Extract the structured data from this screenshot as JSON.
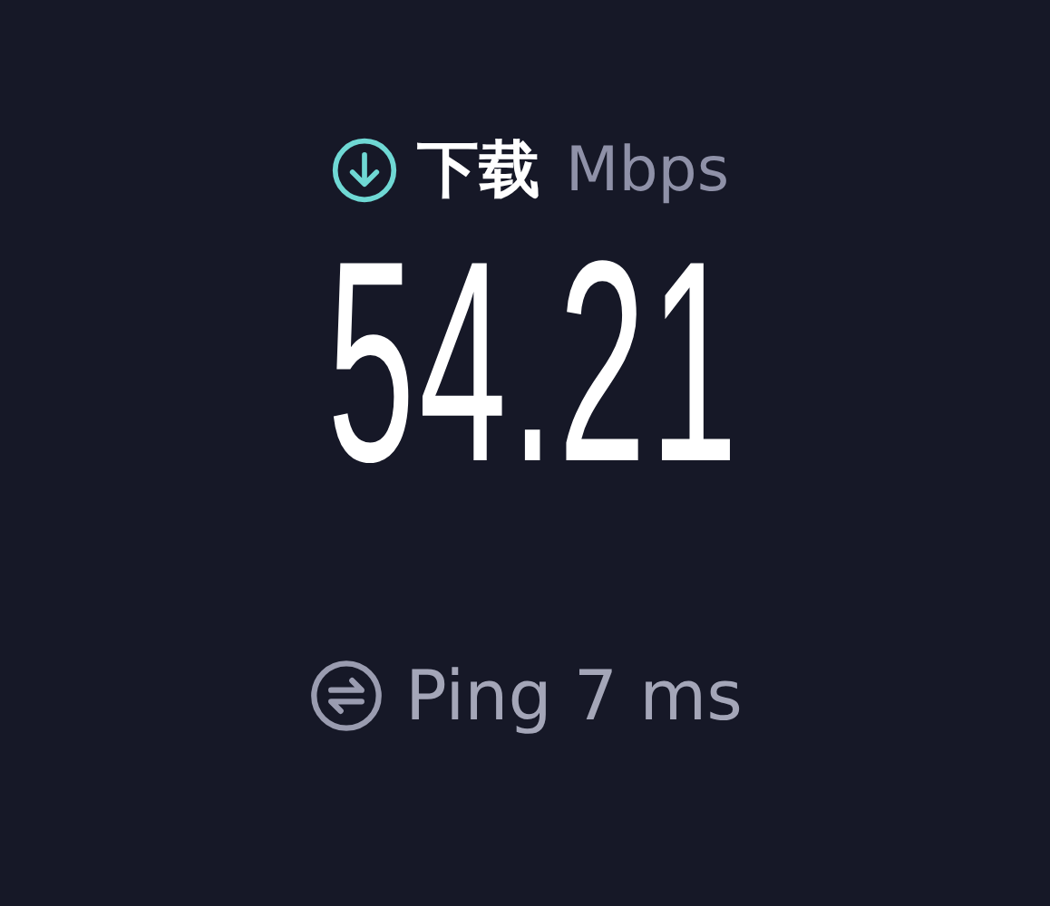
{
  "download": {
    "label": "下载",
    "unit": "Mbps",
    "value": "54.21"
  },
  "ping": {
    "label": "Ping",
    "value": "7 ms"
  }
}
